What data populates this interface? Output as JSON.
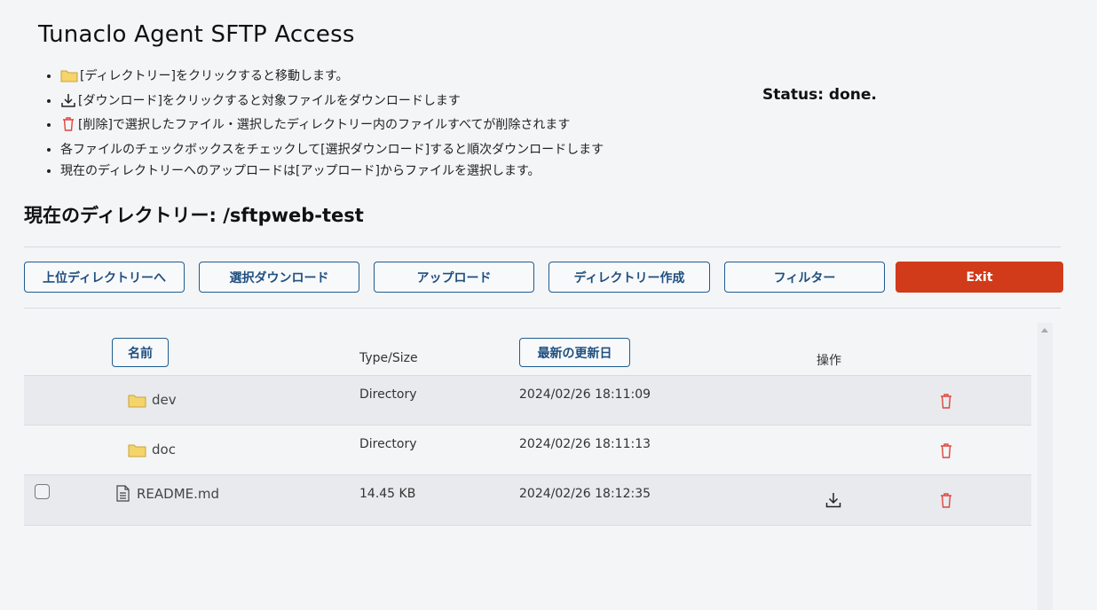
{
  "app": {
    "title": "Tunaclo Agent SFTP Access"
  },
  "instructions": [
    {
      "icon": "folder-icon",
      "text": "[ディレクトリー]をクリックすると移動します。"
    },
    {
      "icon": "download-icon",
      "text": "[ダウンロード]をクリックすると対象ファイルをダウンロードします"
    },
    {
      "icon": "trash-icon",
      "text": "[削除]で選択したファイル・選択したディレクトリー内のファイルすべてが削除されます"
    },
    {
      "icon": "",
      "text": "各ファイルのチェックボックスをチェックして[選択ダウンロード]すると順次ダウンロードします"
    },
    {
      "icon": "",
      "text": "現在のディレクトリーへのアップロードは[アップロード]からファイルを選択します。"
    }
  ],
  "status": {
    "text": "Status: done."
  },
  "current_dir": {
    "text": "現在のディレクトリー: /sftpweb-test"
  },
  "toolbar": {
    "parent_dir": "上位ディレクトリーへ",
    "select_download": "選択ダウンロード",
    "upload": "アップロード",
    "create_dir": "ディレクトリー作成",
    "filter": "フィルター",
    "exit": "Exit"
  },
  "table": {
    "headers": {
      "name": "名前",
      "type_size": "Type/Size",
      "updated": "最新の更新日",
      "actions": "操作"
    },
    "rows": [
      {
        "kind": "directory",
        "icon": "folder-icon",
        "name": "dev",
        "type_size": "Directory",
        "updated": "2024/02/26 18:11:09"
      },
      {
        "kind": "directory",
        "icon": "folder-icon",
        "name": "doc",
        "type_size": "Directory",
        "updated": "2024/02/26 18:11:13"
      },
      {
        "kind": "file",
        "icon": "file-icon",
        "name": "README.md",
        "type_size": "14.45 KB",
        "updated": "2024/02/26 18:12:35"
      }
    ]
  },
  "colors": {
    "accent": "#1f5c8f",
    "exit": "#d13b1a",
    "delete_icon": "#e0453a",
    "folder": "#f5d46a"
  }
}
